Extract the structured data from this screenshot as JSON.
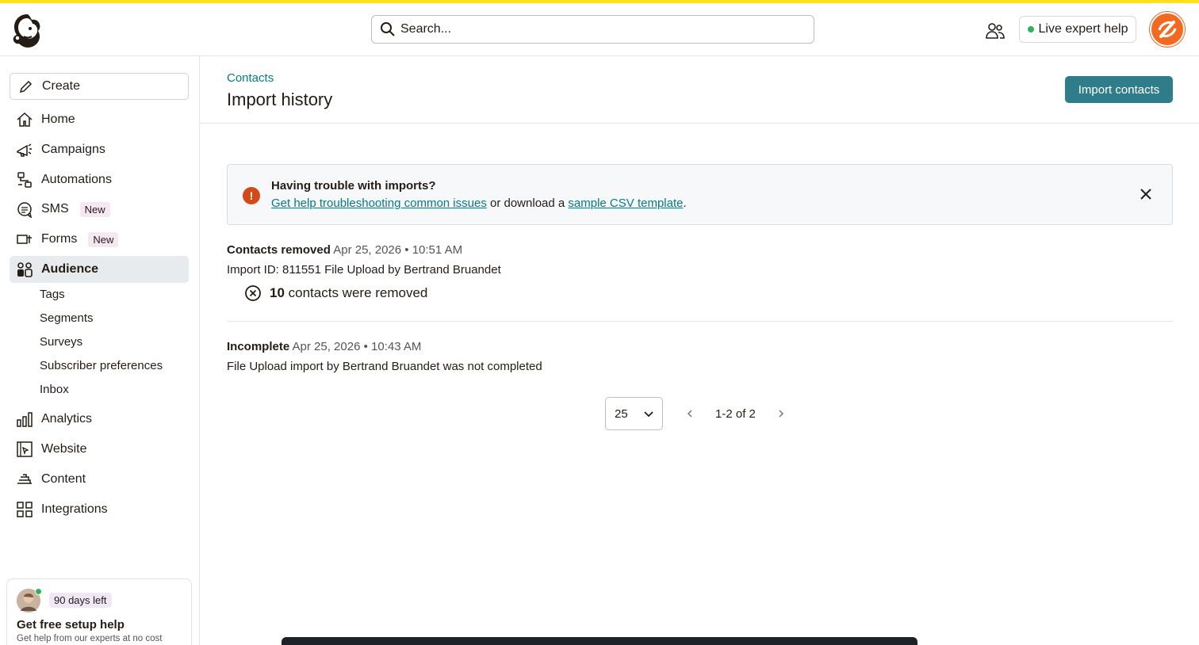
{
  "header": {
    "search_placeholder": "Search...",
    "live_help_label": "Live expert help"
  },
  "sidebar": {
    "create_label": "Create",
    "items": [
      {
        "label": "Home"
      },
      {
        "label": "Campaigns"
      },
      {
        "label": "Automations"
      },
      {
        "label": "SMS",
        "badge": "New"
      },
      {
        "label": "Forms",
        "badge": "New"
      },
      {
        "label": "Audience"
      },
      {
        "label": "Analytics"
      },
      {
        "label": "Website"
      },
      {
        "label": "Content"
      },
      {
        "label": "Integrations"
      }
    ],
    "audience_sub": [
      "Tags",
      "Segments",
      "Surveys",
      "Subscriber preferences",
      "Inbox"
    ],
    "trial": {
      "badge": "90 days left",
      "title": "Get free setup help",
      "subtitle": "Get help from our experts at no cost"
    }
  },
  "main": {
    "breadcrumb": "Contacts",
    "title": "Import history",
    "import_button": "Import contacts",
    "alert": {
      "title": "Having trouble with imports?",
      "link1": "Get help troubleshooting common issues",
      "middle": " or download a ",
      "link2": "sample CSV template",
      "end": "."
    },
    "entries": [
      {
        "status": "Contacts removed",
        "timestamp": "Apr 25, 2026 • 10:51 AM",
        "line": "Import ID: 811551 File Upload by Bertrand Bruandet",
        "count": "10",
        "count_text": " contacts were removed"
      },
      {
        "status": "Incomplete",
        "timestamp": "Apr 25, 2026 • 10:43 AM",
        "line": "File Upload import by Bertrand Bruandet was not completed"
      }
    ],
    "pager": {
      "per_page": "25",
      "range": "1-2 of 2"
    }
  },
  "colors": {
    "accent_yellow": "#ffe01b",
    "teal": "#2f7d8a",
    "link": "#007c89",
    "warning": "#d34a18"
  }
}
